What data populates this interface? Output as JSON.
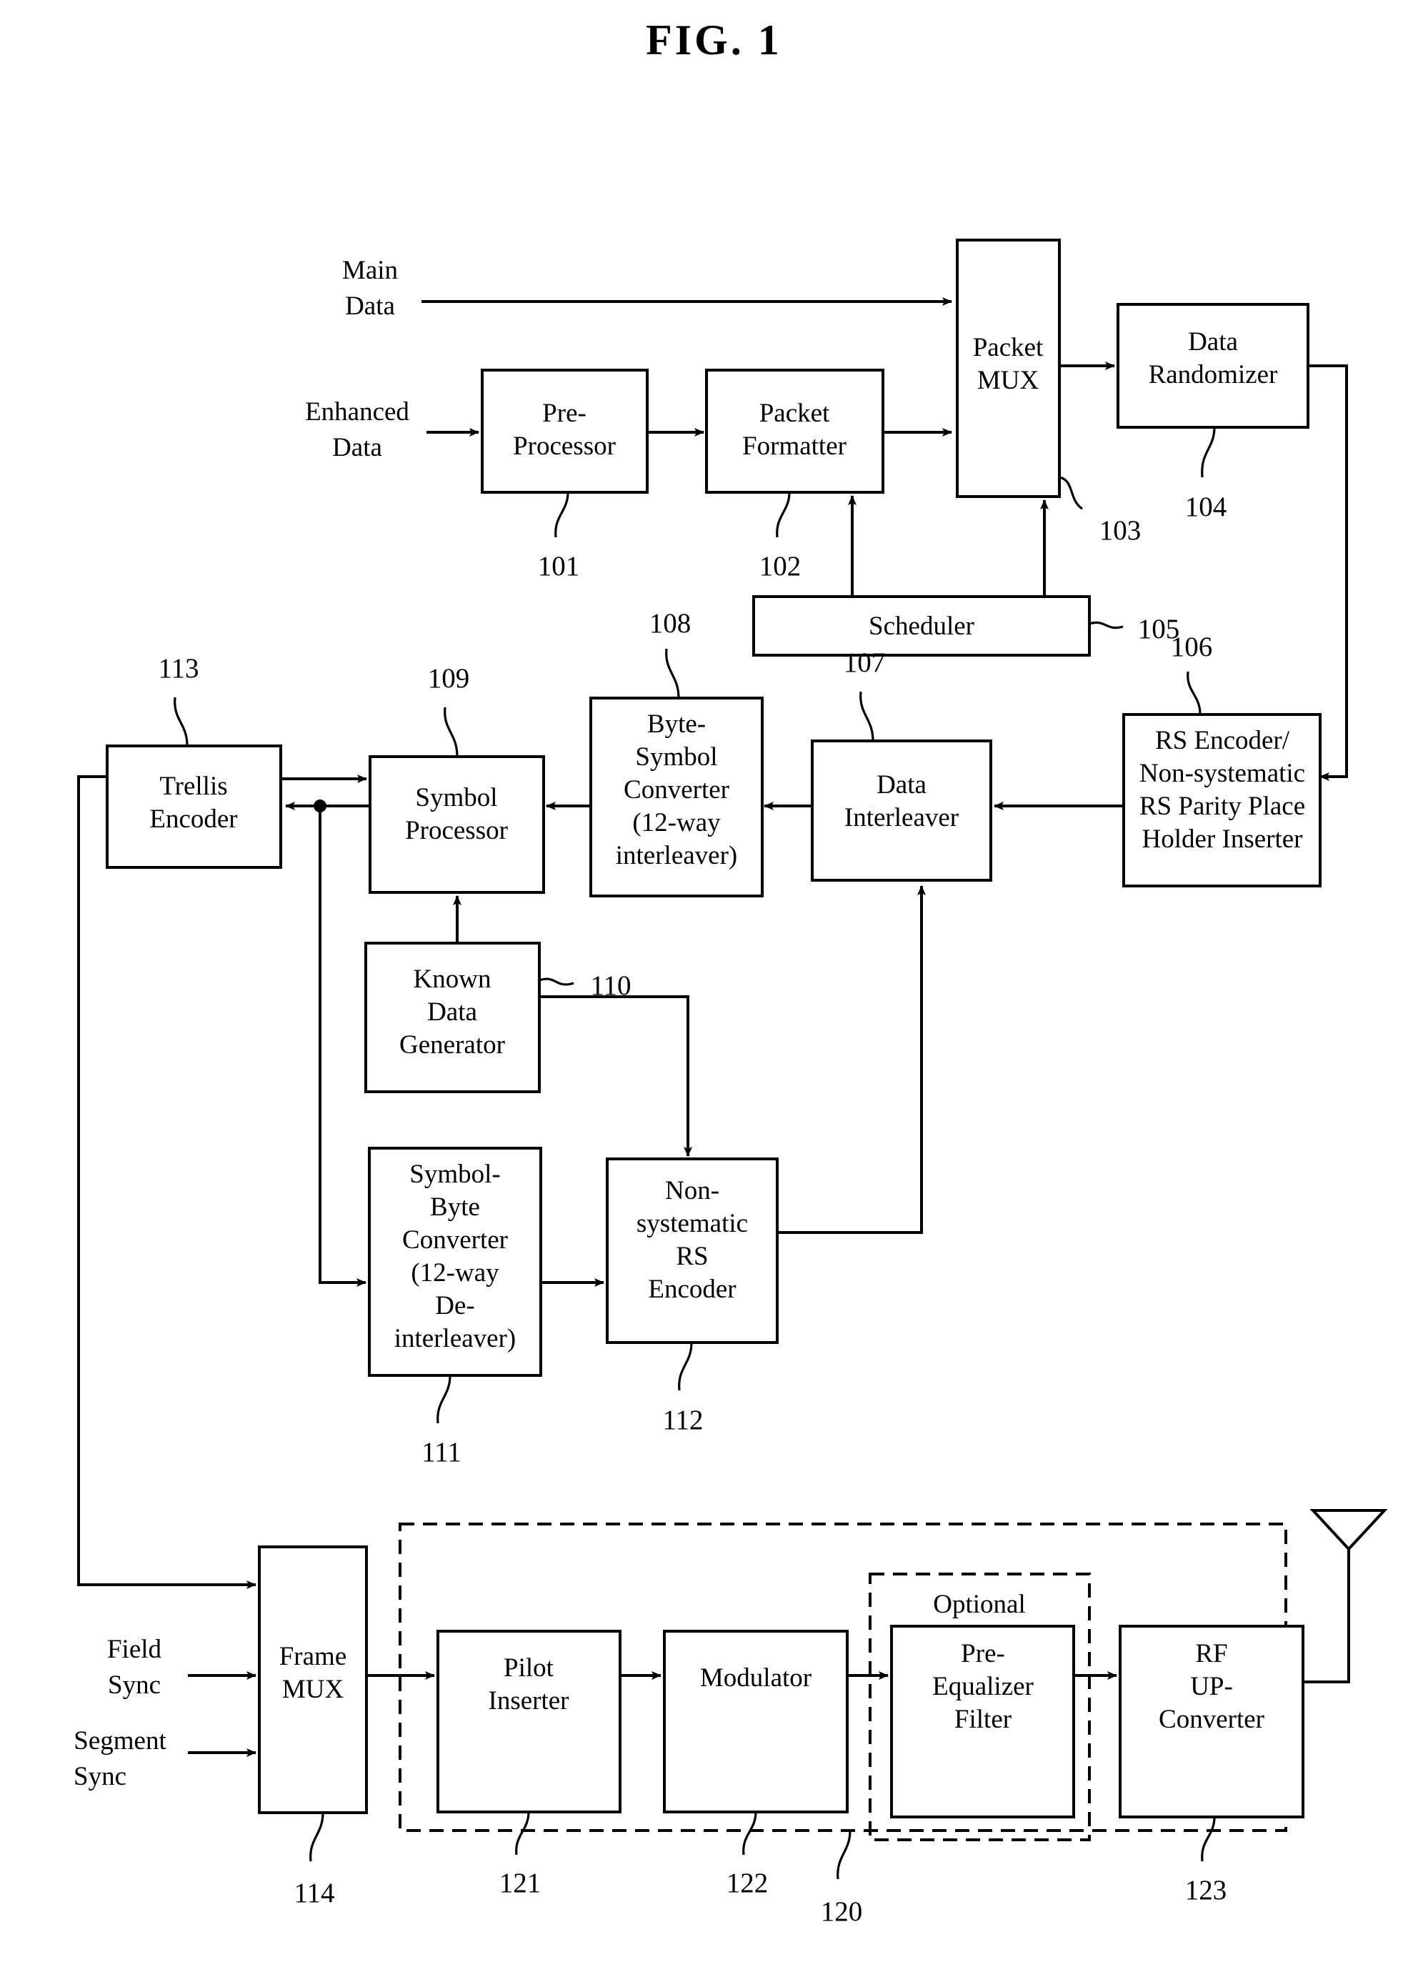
{
  "figure": {
    "title": "FIG. 1",
    "domain_note": "patent block diagram"
  },
  "inputs": [
    {
      "id": "main-data",
      "line1": "Main",
      "line2": "Data"
    },
    {
      "id": "enhanced-data",
      "line1": "Enhanced",
      "line2": "Data"
    },
    {
      "id": "field-sync",
      "line1": "Field",
      "line2": "Sync"
    },
    {
      "id": "segment-sync",
      "line1": "Segment",
      "line2": "Sync"
    }
  ],
  "blocks": [
    {
      "id": "pre-processor",
      "ref": "101",
      "lines": [
        "Pre-",
        "Processor"
      ]
    },
    {
      "id": "packet-formatter",
      "ref": "102",
      "lines": [
        "Packet",
        "Formatter"
      ]
    },
    {
      "id": "packet-mux",
      "ref": "103",
      "lines": [
        "Packet",
        "MUX"
      ]
    },
    {
      "id": "data-randomizer",
      "ref": "104",
      "lines": [
        "Data",
        "Randomizer"
      ]
    },
    {
      "id": "scheduler",
      "ref": "105",
      "lines": [
        "Scheduler"
      ]
    },
    {
      "id": "rs-encoder",
      "ref": "106",
      "lines": [
        "RS Encoder/",
        "Non-systematic",
        "RS Parity Place",
        "Holder Inserter"
      ]
    },
    {
      "id": "data-interleaver",
      "ref": "107",
      "lines": [
        "Data",
        "Interleaver"
      ]
    },
    {
      "id": "byte-symbol-converter",
      "ref": "108",
      "lines": [
        "Byte-",
        "Symbol",
        "Converter",
        "(12-way",
        "interleaver)"
      ]
    },
    {
      "id": "symbol-processor",
      "ref": "109",
      "lines": [
        "Symbol",
        "Processor"
      ]
    },
    {
      "id": "known-data-generator",
      "ref": "110",
      "lines": [
        "Known",
        "Data",
        "Generator"
      ]
    },
    {
      "id": "symbol-byte-converter",
      "ref": "111",
      "lines": [
        "Symbol-",
        "Byte",
        "Converter",
        "(12-way",
        "De-",
        "interleaver)"
      ]
    },
    {
      "id": "nonsystematic-rs-encoder",
      "ref": "112",
      "lines": [
        "Non-",
        "systematic",
        "RS",
        "Encoder"
      ]
    },
    {
      "id": "trellis-encoder",
      "ref": "113",
      "lines": [
        "Trellis",
        "Encoder"
      ]
    },
    {
      "id": "frame-mux",
      "ref": "114",
      "lines": [
        "Frame",
        "MUX"
      ]
    },
    {
      "id": "pilot-inserter",
      "ref": "121",
      "lines": [
        "Pilot",
        "Inserter"
      ]
    },
    {
      "id": "modulator",
      "ref": "122",
      "lines": [
        "Modulator"
      ]
    },
    {
      "id": "pre-equalizer-filter",
      "ref": "",
      "lines": [
        "Pre-",
        "Equalizer",
        "Filter"
      ]
    },
    {
      "id": "rf-up-converter",
      "ref": "123",
      "lines": [
        "RF",
        "UP-",
        "Converter"
      ]
    }
  ],
  "groups": [
    {
      "id": "optional-group",
      "label": "Optional",
      "ref": ""
    },
    {
      "id": "transmitter-group",
      "label": "",
      "ref": "120"
    }
  ],
  "text": {
    "main_data_l1": "Main",
    "main_data_l2": "Data",
    "enhanced_data_l1": "Enhanced",
    "enhanced_data_l2": "Data",
    "field_sync_l1": "Field",
    "field_sync_l2": "Sync",
    "segment_sync_l1": "Segment",
    "segment_sync_l2": "Sync",
    "pre_processor_l1": "Pre-",
    "pre_processor_l2": "Processor",
    "packet_formatter_l1": "Packet",
    "packet_formatter_l2": "Formatter",
    "packet_mux_l1": "Packet",
    "packet_mux_l2": "MUX",
    "data_randomizer_l1": "Data",
    "data_randomizer_l2": "Randomizer",
    "scheduler_l1": "Scheduler",
    "rs_encoder_l1": "RS Encoder/",
    "rs_encoder_l2": "Non-systematic",
    "rs_encoder_l3": "RS Parity Place",
    "rs_encoder_l4": "Holder Inserter",
    "data_interleaver_l1": "Data",
    "data_interleaver_l2": "Interleaver",
    "byte_symbol_l1": "Byte-",
    "byte_symbol_l2": "Symbol",
    "byte_symbol_l3": "Converter",
    "byte_symbol_l4": "(12-way",
    "byte_symbol_l5": "interleaver)",
    "symbol_processor_l1": "Symbol",
    "symbol_processor_l2": "Processor",
    "known_data_l1": "Known",
    "known_data_l2": "Data",
    "known_data_l3": "Generator",
    "symbol_byte_l1": "Symbol-",
    "symbol_byte_l2": "Byte",
    "symbol_byte_l3": "Converter",
    "symbol_byte_l4": "(12-way",
    "symbol_byte_l5": "De-",
    "symbol_byte_l6": "interleaver)",
    "nonsys_rs_l1": "Non-",
    "nonsys_rs_l2": "systematic",
    "nonsys_rs_l3": "RS",
    "nonsys_rs_l4": "Encoder",
    "trellis_l1": "Trellis",
    "trellis_l2": "Encoder",
    "frame_mux_l1": "Frame",
    "frame_mux_l2": "MUX",
    "pilot_l1": "Pilot",
    "pilot_l2": "Inserter",
    "modulator_l1": "Modulator",
    "optional_label": "Optional",
    "preeq_l1": "Pre-",
    "preeq_l2": "Equalizer",
    "preeq_l3": "Filter",
    "rf_l1": "RF",
    "rf_l2": "UP-",
    "rf_l3": "Converter"
  },
  "refs": {
    "r101": "101",
    "r102": "102",
    "r103": "103",
    "r104": "104",
    "r105": "105",
    "r106": "106",
    "r107": "107",
    "r108": "108",
    "r109": "109",
    "r110": "110",
    "r111": "111",
    "r112": "112",
    "r113": "113",
    "r114": "114",
    "r120": "120",
    "r121": "121",
    "r122": "122",
    "r123": "123"
  },
  "colors": {
    "ink": "#000000",
    "paper": "#ffffff"
  }
}
